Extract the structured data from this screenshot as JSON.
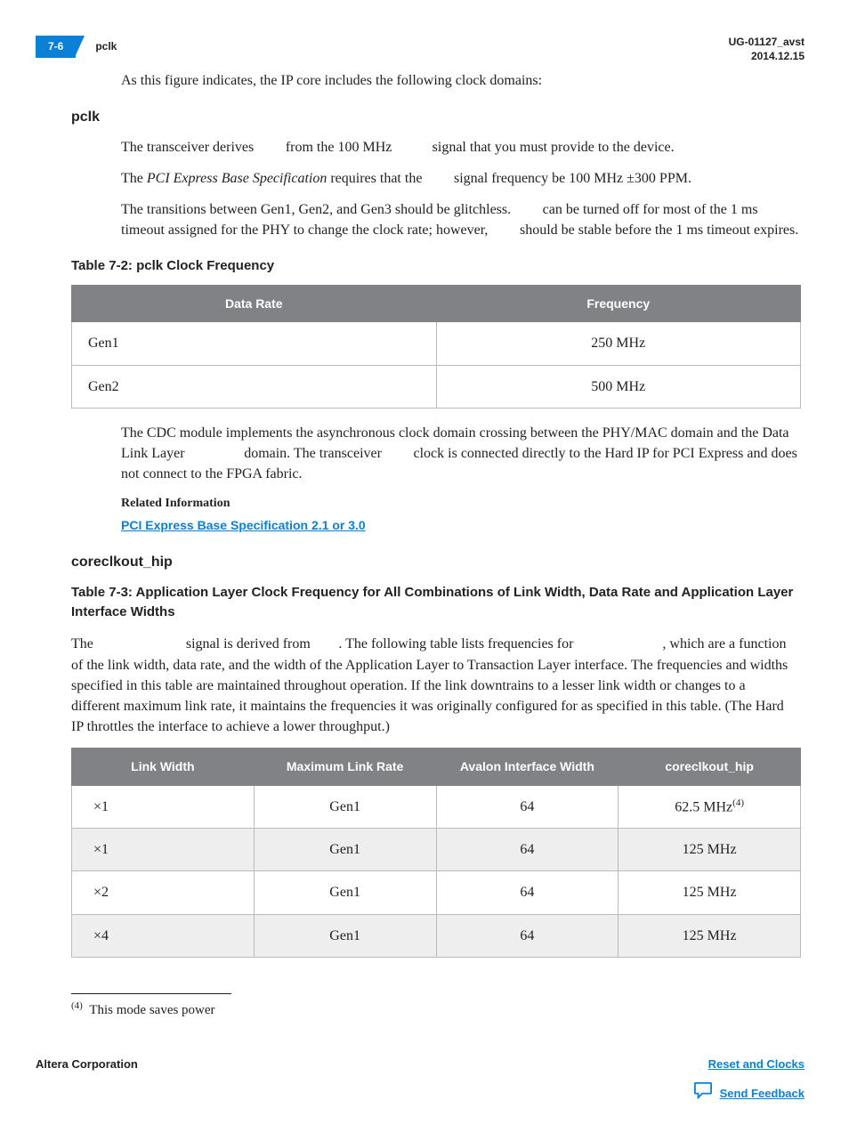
{
  "header": {
    "page_num": "7-6",
    "section": "pclk",
    "doc_id": "UG-01127_avst",
    "date": "2014.12.15"
  },
  "intro_para": "As this figure indicates, the IP core includes the following clock domains:",
  "pclk": {
    "heading": "pclk",
    "p1_a": "The transceiver derives ",
    "p1_b": " from the 100 MHz ",
    "p1_c": " signal that you must provide to the device.",
    "p2_a": "The ",
    "p2_spec": "PCI Express Base Specification",
    "p2_b": " requires that the ",
    "p2_c": " signal frequency be 100 MHz ±300 PPM.",
    "p3_a": "The transitions between Gen1, Gen2, and Gen3 should be glitchless. ",
    "p3_b": " can be turned off for most of the 1 ms timeout assigned for the PHY to change the clock rate; however, ",
    "p3_c": " should be stable before the 1 ms timeout expires."
  },
  "table72": {
    "caption": "Table 7-2: pclk Clock Frequency",
    "headers": {
      "c1": "Data Rate",
      "c2": "Frequency"
    },
    "rows": [
      {
        "c1": "Gen1",
        "c2": "250 MHz"
      },
      {
        "c1": "Gen2",
        "c2": "500 MHz"
      }
    ]
  },
  "cdc_para_a": "The CDC module implements the asynchronous clock domain crossing between the PHY/MAC domain and the Data Link Layer ",
  "cdc_para_b": " domain. The transceiver ",
  "cdc_para_c": " clock is connected directly to the Hard IP for PCI Express and does not connect to the FPGA fabric.",
  "related": {
    "title": "Related Information",
    "link_text": "PCI Express Base Specification 2.1 or 3.0"
  },
  "coreclkout": {
    "heading": "coreclkout_hip",
    "table_caption": "Table 7-3: Application Layer Clock Frequency for All Combinations of Link Width, Data Rate and Application Layer Interface Widths",
    "para_a": "The ",
    "para_b": " signal is derived from ",
    "para_c": ". The following table lists frequencies for ",
    "para_d": ", which are a function of the link width, data rate, and the width of the Application Layer to Transaction Layer interface. The frequencies and widths specified in this table are maintained throughout operation. If the link downtrains to a lesser link width or changes to a different maximum link rate, it maintains the frequencies it was originally configured for as specified in this table. (The Hard IP throttles the interface to achieve a lower throughput.)"
  },
  "table73": {
    "headers": {
      "c1": "Link Width",
      "c2": "Maximum Link Rate",
      "c3": "Avalon Interface Width",
      "c4": "coreclkout_hip"
    },
    "rows": [
      {
        "c1": "×1",
        "c2": "Gen1",
        "c3": "64",
        "c4_val": "62.5 MHz",
        "c4_sup": "(4)"
      },
      {
        "c1": "×1",
        "c2": "Gen1",
        "c3": "64",
        "c4_val": "125 MHz",
        "c4_sup": ""
      },
      {
        "c1": "×2",
        "c2": "Gen1",
        "c3": "64",
        "c4_val": "125 MHz",
        "c4_sup": ""
      },
      {
        "c1": "×4",
        "c2": "Gen1",
        "c3": "64",
        "c4_val": "125 MHz",
        "c4_sup": ""
      }
    ]
  },
  "chart_data": [
    {
      "type": "table",
      "title": "Table 7-2: pclk Clock Frequency",
      "columns": [
        "Data Rate",
        "Frequency"
      ],
      "rows": [
        [
          "Gen1",
          "250 MHz"
        ],
        [
          "Gen2",
          "500 MHz"
        ]
      ]
    },
    {
      "type": "table",
      "title": "Table 7-3: Application Layer Clock Frequency for All Combinations of Link Width, Data Rate and Application Layer Interface Widths",
      "columns": [
        "Link Width",
        "Maximum Link Rate",
        "Avalon Interface Width",
        "coreclkout_hip"
      ],
      "rows": [
        [
          "×1",
          "Gen1",
          "64",
          "62.5 MHz"
        ],
        [
          "×1",
          "Gen1",
          "64",
          "125 MHz"
        ],
        [
          "×2",
          "Gen1",
          "64",
          "125 MHz"
        ],
        [
          "×4",
          "Gen1",
          "64",
          "125 MHz"
        ]
      ]
    }
  ],
  "footnote": {
    "marker": "(4)",
    "text": "This mode saves power"
  },
  "footer": {
    "corp": "Altera Corporation",
    "right_link": "Reset and Clocks",
    "feedback": "Send Feedback"
  }
}
